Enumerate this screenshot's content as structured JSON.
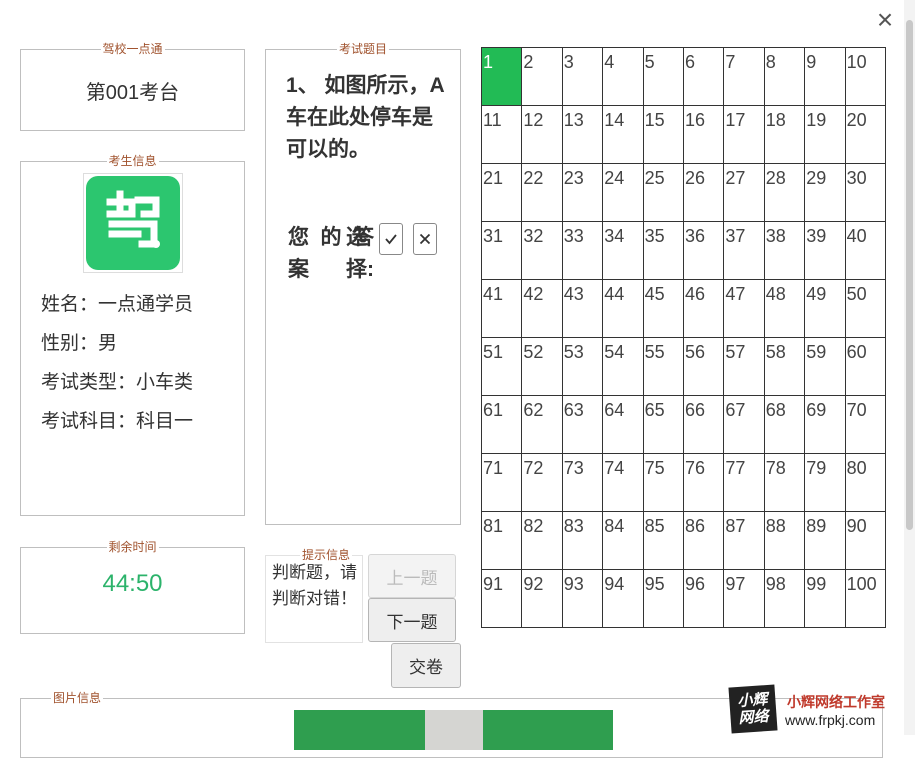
{
  "school": {
    "legend": "驾校一点通",
    "station": "第001考台"
  },
  "examinee": {
    "legend": "考生信息",
    "name_line": "姓名：一点通学员",
    "gender_line": "性别：男",
    "type_line": "考试类型：小车类",
    "subject_line": "考试科目：科目一"
  },
  "timer": {
    "legend": "剩余时间",
    "value": "44:50"
  },
  "question": {
    "legend": "考试题目",
    "text": "1、 如图所示，A车在此处停车是可以的。",
    "answer_label": "您的答案:",
    "choose_label": "选择:"
  },
  "hint": {
    "legend": "提示信息",
    "text": "判断题，请判断对错！"
  },
  "buttons": {
    "prev": "上一题",
    "next": "下一题",
    "submit": "交卷"
  },
  "grid": {
    "current": 1,
    "cells": [
      "1",
      "2",
      "3",
      "4",
      "5",
      "6",
      "7",
      "8",
      "9",
      "10",
      "11",
      "12",
      "13",
      "14",
      "15",
      "16",
      "17",
      "18",
      "19",
      "20",
      "21",
      "22",
      "23",
      "24",
      "25",
      "26",
      "27",
      "28",
      "29",
      "30",
      "31",
      "32",
      "33",
      "34",
      "35",
      "36",
      "37",
      "38",
      "39",
      "40",
      "41",
      "42",
      "43",
      "44",
      "45",
      "46",
      "47",
      "48",
      "49",
      "50",
      "51",
      "52",
      "53",
      "54",
      "55",
      "56",
      "57",
      "58",
      "59",
      "60",
      "61",
      "62",
      "63",
      "64",
      "65",
      "66",
      "67",
      "68",
      "69",
      "70",
      "71",
      "72",
      "73",
      "74",
      "75",
      "76",
      "77",
      "78",
      "79",
      "80",
      "81",
      "82",
      "83",
      "84",
      "85",
      "86",
      "87",
      "88",
      "89",
      "90",
      "91",
      "92",
      "93",
      "94",
      "95",
      "96",
      "97",
      "98",
      "99",
      "100"
    ]
  },
  "image_panel": {
    "legend": "图片信息"
  },
  "watermark": {
    "logo_line1": "小辉",
    "logo_line2": "网络",
    "name": "小辉网络工作室",
    "url": "www.frpkj.com"
  },
  "colors": {
    "accent_green": "#22bb55",
    "legend_brown": "#a0522d",
    "timer_green": "#2cb36b"
  },
  "icons": {
    "close": "close-icon",
    "check": "check-icon",
    "cross": "cross-icon",
    "avatar": "drive-logo-icon"
  }
}
